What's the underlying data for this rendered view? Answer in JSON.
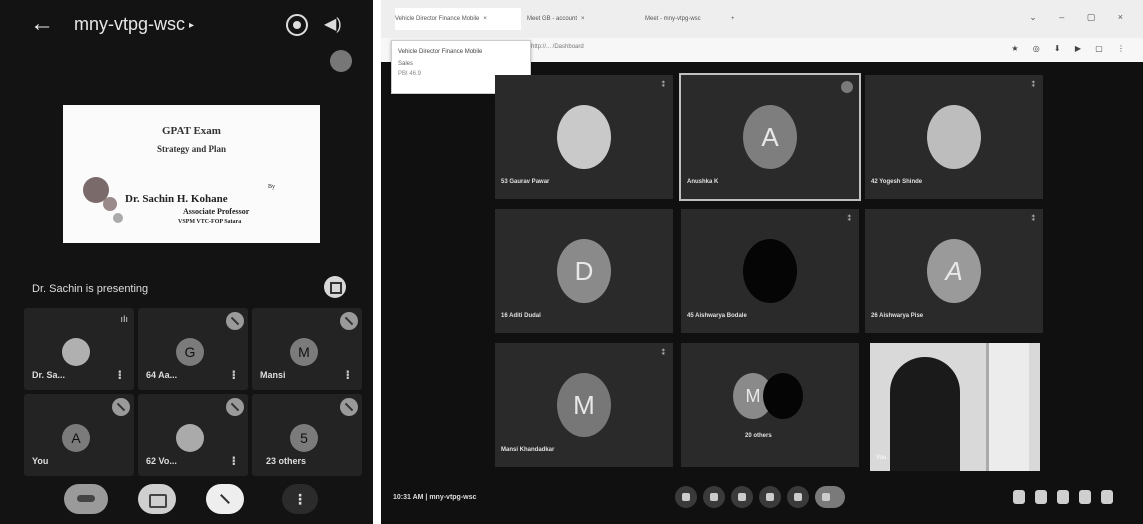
{
  "phone": {
    "meeting_code": "mny-vtpg-wsc",
    "slide": {
      "title": "GPAT Exam",
      "subtitle": "Strategy and Plan",
      "by": "By",
      "presenter": "Dr. Sachin H. Kohane",
      "role": "Associate Professor",
      "institution": "VSPM VTC-FOP Satara"
    },
    "presenting_text": "Dr. Sachin is presenting",
    "tiles": [
      {
        "avatar": "",
        "label": "Dr. Sa..."
      },
      {
        "avatar": "G",
        "label": "64 Aa..."
      },
      {
        "avatar": "M",
        "label": "Mansi"
      },
      {
        "avatar": "A",
        "label": "You"
      },
      {
        "avatar": "",
        "label": "62 Vo..."
      },
      {
        "avatar": "5",
        "label": "23 others"
      }
    ],
    "more_label": "⋮"
  },
  "browser": {
    "tabs": [
      {
        "label": "Vehicle Director Finance Mobile"
      },
      {
        "label": "Meet GB - account"
      },
      {
        "label": "Meet - mny-vtpg-wsc"
      },
      {
        "label": "+ "
      }
    ],
    "tooltip": {
      "title": "Vehicle Director Finance Mobile",
      "subtitle": "Sales",
      "memory": "PBI 46.9"
    },
    "url": "http://... /Dashboard"
  },
  "meet": {
    "tiles": [
      {
        "avatar": "",
        "label": "53 Gaurav Pawar"
      },
      {
        "avatar": "A",
        "label": "Anushka K"
      },
      {
        "avatar": "",
        "label": "42 Yogesh Shinde"
      },
      {
        "avatar": "D",
        "label": "16 Aditi Dudal"
      },
      {
        "avatar": "",
        "label": "45 Aishwarya Bodale"
      },
      {
        "avatar": "A",
        "label": "26 Aishwarya Pise"
      },
      {
        "avatar": "M",
        "label": "Mansi Khandadkar"
      },
      {
        "avatar": "M",
        "label": "20 others"
      }
    ],
    "self_label": "You",
    "bottom_time": "10:31 AM | mny-vtpg-wsc"
  }
}
